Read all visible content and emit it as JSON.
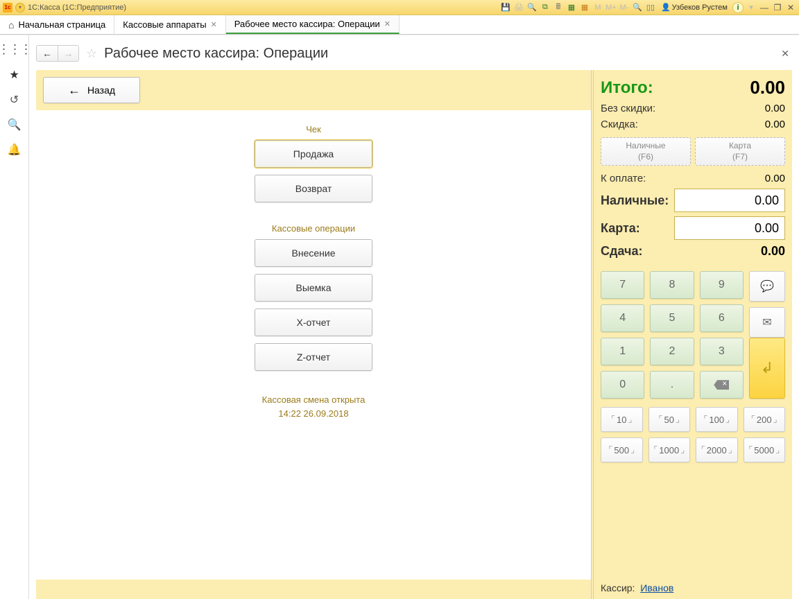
{
  "titlebar": {
    "app_title": "1С:Касса  (1С:Предприятие)",
    "user_name": "Узбеков Рустем",
    "memory_labels": [
      "M",
      "M+",
      "M-"
    ]
  },
  "tabs": {
    "home": "Начальная страница",
    "t1": "Кассовые аппараты",
    "t2": "Рабочее место кассира: Операции"
  },
  "page": {
    "title": "Рабочее место кассира: Операции",
    "back": "Назад",
    "group_receipt": "Чек",
    "btn_sale": "Продажа",
    "btn_return": "Возврат",
    "group_cashops": "Кассовые операции",
    "btn_deposit": "Внесение",
    "btn_withdraw": "Выемка",
    "btn_xreport": "Х-отчет",
    "btn_zreport": "Z-отчет",
    "shift_line1": "Кассовая смена открыта",
    "shift_line2": "14:22 26.09.2018"
  },
  "totals": {
    "total_label": "Итого:",
    "total_value": "0.00",
    "nodiscount_label": "Без скидки:",
    "nodiscount_value": "0.00",
    "discount_label": "Скидка:",
    "discount_value": "0.00",
    "cashbtn_label": "Наличные",
    "cashbtn_hint": "(F6)",
    "cardbtn_label": "Карта",
    "cardbtn_hint": "(F7)",
    "topay_label": "К оплате:",
    "topay_value": "0.00",
    "cash_label": "Наличные:",
    "cash_value": "0.00",
    "card_label": "Карта:",
    "card_value": "0.00",
    "change_label": "Сдача:",
    "change_value": "0.00",
    "keypad": {
      "k7": "7",
      "k8": "8",
      "k9": "9",
      "k4": "4",
      "k5": "5",
      "k6": "6",
      "k1": "1",
      "k2": "2",
      "k3": "3",
      "k0": "0",
      "kdot": "."
    },
    "denoms": {
      "d10": "10",
      "d50": "50",
      "d100": "100",
      "d200": "200",
      "d500": "500",
      "d1000": "1000",
      "d2000": "2000",
      "d5000": "5000"
    },
    "cashier_label": "Кассир:",
    "cashier_name": "Иванов"
  }
}
